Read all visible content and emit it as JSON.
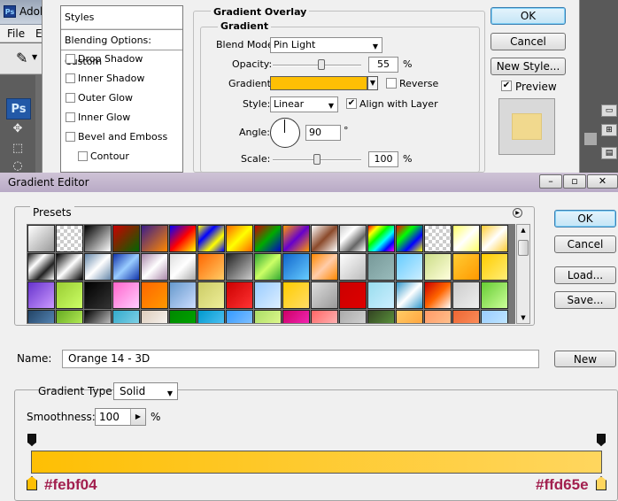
{
  "app": {
    "title": "Adob",
    "ps_icon": "Ps",
    "menu": [
      "File",
      "Ec"
    ]
  },
  "layer_style": {
    "styles_header": "Styles",
    "blending_options": "Blending Options: Custom",
    "effects": [
      "Drop Shadow",
      "Inner Shadow",
      "Outer Glow",
      "Inner Glow",
      "Bevel and Emboss",
      "Contour"
    ],
    "section_title": "Gradient Overlay",
    "subsection_title": "Gradient",
    "blend_mode_label": "Blend Mode:",
    "blend_mode_value": "Pin Light",
    "opacity_label": "Opacity:",
    "opacity_value": "55",
    "opacity_unit": "%",
    "opacity_fraction": 0.55,
    "gradient_label": "Gradient:",
    "reverse_label": "Reverse",
    "style_label": "Style:",
    "style_value": "Linear",
    "align_label": "Align with Layer",
    "angle_label": "Angle:",
    "angle_value": "90",
    "angle_unit": "°",
    "scale_label": "Scale:",
    "scale_value": "100",
    "scale_unit": "%",
    "scale_fraction": 0.5,
    "ok": "OK",
    "cancel": "Cancel",
    "new_style": "New Style...",
    "preview_label": "Preview",
    "preview_checked": true,
    "align_checked": true,
    "reverse_checked": false
  },
  "gradient_editor": {
    "title": "Gradient Editor",
    "presets_label": "Presets",
    "buttons": {
      "ok": "OK",
      "cancel": "Cancel",
      "load": "Load...",
      "save": "Save...",
      "new": "New"
    },
    "name_label": "Name:",
    "name_value": "Orange 14 - 3D",
    "gradient_type_label": "Gradient Type:",
    "gradient_type_value": "Solid",
    "smoothness_label": "Smoothness:",
    "smoothness_value": "100",
    "smoothness_unit": "%",
    "stop_left_hex": "#febf04",
    "stop_right_hex": "#ffd65e",
    "stop_left_color": "#febf04",
    "stop_right_color": "#ffd65e",
    "presets": [
      "linear-gradient(135deg,#fff,#999)",
      "repeating-conic-gradient(#ccc 0 25%,#fff 0 50%) 0 0/8px 8px",
      "linear-gradient(135deg,#000,#fff)",
      "linear-gradient(135deg,#c00,#060)",
      "linear-gradient(135deg,#3a1d8a,#f80)",
      "linear-gradient(135deg,#00f,#f00,#ff0)",
      "linear-gradient(135deg,#ff0,#00f,#ff0,#00f)",
      "linear-gradient(135deg,#f60,#ff0,#f60)",
      "linear-gradient(135deg,#c00,#0a0,#00c)",
      "linear-gradient(135deg,#f90,#60c,#f90)",
      "linear-gradient(135deg,#fff,#8b4a2b,#fff)",
      "linear-gradient(135deg,#ccc,#fff,#666,#fff)",
      "linear-gradient(135deg,#f00,#ff0,#0f0,#0ff,#00f,#f0f)",
      "linear-gradient(135deg,#f00,#0f0,#00f,#ff0)",
      "repeating-conic-gradient(#ccc 0 25%,#fff 0 50%) 0 0/8px 8px",
      "linear-gradient(135deg,#ff6,#fff,#ff6)",
      "linear-gradient(135deg,#fc3,#fff,#fc3)",
      "linear-gradient(135deg,#222,#fff,#222,#fff)",
      "linear-gradient(135deg,#000,#fff,#000)",
      "linear-gradient(135deg,#68a,#fff,#68a)",
      "linear-gradient(135deg,#13a,#9cf,#13a)",
      "linear-gradient(135deg,#a8a,#fff,#a8a)",
      "linear-gradient(135deg,#ddd,#fff,#aaa)",
      "linear-gradient(135deg,#f60,#fc6)",
      "linear-gradient(135deg,#222,#ccc)",
      "linear-gradient(135deg,#3a3,#cf6,#3a3)",
      "linear-gradient(135deg,#16c,#6cf)",
      "linear-gradient(135deg,#f80,#fca,#f80)",
      "linear-gradient(135deg,#fff,#bbb)",
      "linear-gradient(135deg,#799,#9bb)",
      "linear-gradient(135deg,#6cf,#cef)",
      "linear-gradient(135deg,#cd8,#ffd)",
      "linear-gradient(135deg,#fc3,#f90)",
      "linear-gradient(135deg,#fc0,#fe7)",
      "linear-gradient(135deg,#63c,#c9f)",
      "linear-gradient(135deg,#9c3,#cf6)",
      "linear-gradient(135deg,#000,#333)",
      "linear-gradient(135deg,#f6c,#fcf)",
      "linear-gradient(135deg,#f60,#f90)",
      "linear-gradient(135deg,#69c,#cdf)",
      "linear-gradient(135deg,#cc6,#ee9)",
      "linear-gradient(135deg,#c00,#f33)",
      "linear-gradient(135deg,#9cf,#def)",
      "linear-gradient(135deg,#fc0,#fd6)",
      "linear-gradient(135deg,#ddd,#999)",
      "linear-gradient(135deg,#c00,#d00)",
      "linear-gradient(135deg,#9de,#cef)",
      "linear-gradient(135deg,#39c,#fff,#39c)",
      "linear-gradient(135deg,#c00,#f60,#fff)",
      "linear-gradient(135deg,#ccc,#eee)",
      "linear-gradient(135deg,#6c3,#cf9)",
      "linear-gradient(135deg,#246,#69c)",
      "linear-gradient(135deg,#6a2,#cf6)",
      "linear-gradient(135deg,#000,#fff)",
      "linear-gradient(135deg,#3ac,#9de)",
      "linear-gradient(135deg,#dcb,#fff)",
      "linear-gradient(135deg,#080,#0a0)",
      "linear-gradient(135deg,#09c,#6cf)",
      "linear-gradient(135deg,#39f,#9cf)",
      "linear-gradient(135deg,#ad6,#ef9)",
      "linear-gradient(135deg,#c06,#f3c)",
      "linear-gradient(135deg,#f66,#fcc)",
      "linear-gradient(135deg,#aaa,#ddd)",
      "linear-gradient(135deg,#342,#6a4)",
      "linear-gradient(135deg,#fc6,#f93)",
      "linear-gradient(135deg,#f96,#fc9)",
      "linear-gradient(135deg,#e63,#f96)",
      "linear-gradient(135deg,#9cf,#cef)"
    ]
  }
}
